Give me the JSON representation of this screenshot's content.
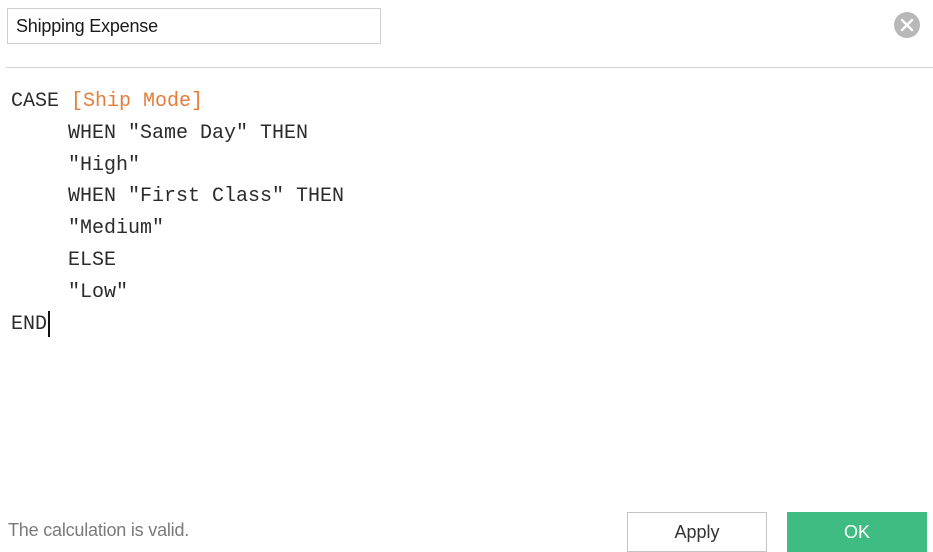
{
  "calc_name": {
    "value": "Shipping Expense"
  },
  "close_icon": "close-circle-icon",
  "editor": {
    "lines": [
      {
        "keyword": "CASE ",
        "field": "[Ship Mode]"
      },
      {
        "text": "WHEN \"Same Day\" THEN"
      },
      {
        "text": "\"High\""
      },
      {
        "text": "WHEN \"First Class\" THEN"
      },
      {
        "text": "\"Medium\""
      },
      {
        "text": "ELSE"
      },
      {
        "text": "\"Low\""
      },
      {
        "text": "END"
      }
    ]
  },
  "status": {
    "message": "The calculation is valid."
  },
  "buttons": {
    "apply_label": "Apply",
    "ok_label": "OK"
  },
  "colors": {
    "field_reference": "#e57c3a",
    "ok_button": "#3fbc82",
    "close_icon": "#b8b8b8"
  }
}
